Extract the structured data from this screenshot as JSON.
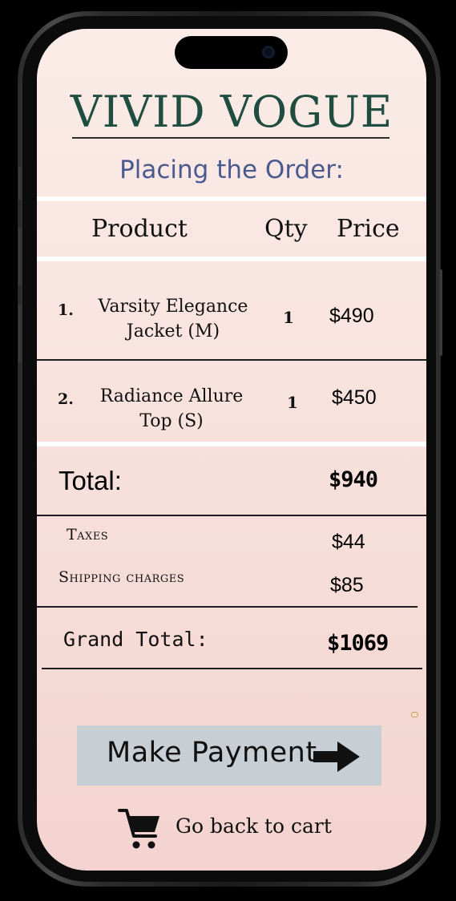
{
  "brand": {
    "name": "VIVID VOGUE",
    "brand_color": "#1f4d3f"
  },
  "subtitle": "Placing the Order:",
  "table": {
    "headers": {
      "product": "Product",
      "qty": "Qty",
      "price": "Price"
    },
    "rows": [
      {
        "index": "1.",
        "name_line1": "Varsity Elegance",
        "name_line2": "Jacket (M)",
        "qty": "1",
        "price": "$490"
      },
      {
        "index": "2.",
        "name_line1": "Radiance Allure",
        "name_line2": "Top (S)",
        "qty": "1",
        "price": "$450"
      }
    ]
  },
  "summary": {
    "total_label": "Total:",
    "total_value": "$940",
    "taxes_label": "Taxes",
    "taxes_value": "$44",
    "shipping_label": "Shipping charges",
    "shipping_value": "$85",
    "grand_total_label": "Grand Total:",
    "grand_total_value": "$1069"
  },
  "actions": {
    "make_payment": "Make Payment",
    "make_payment_icon": "arrow-right-icon",
    "back_to_cart": "Go back to cart",
    "back_icon": "shopping-cart-icon"
  },
  "colors": {
    "button_bg": "#c7ced4",
    "subtitle": "#4a5a8f"
  }
}
